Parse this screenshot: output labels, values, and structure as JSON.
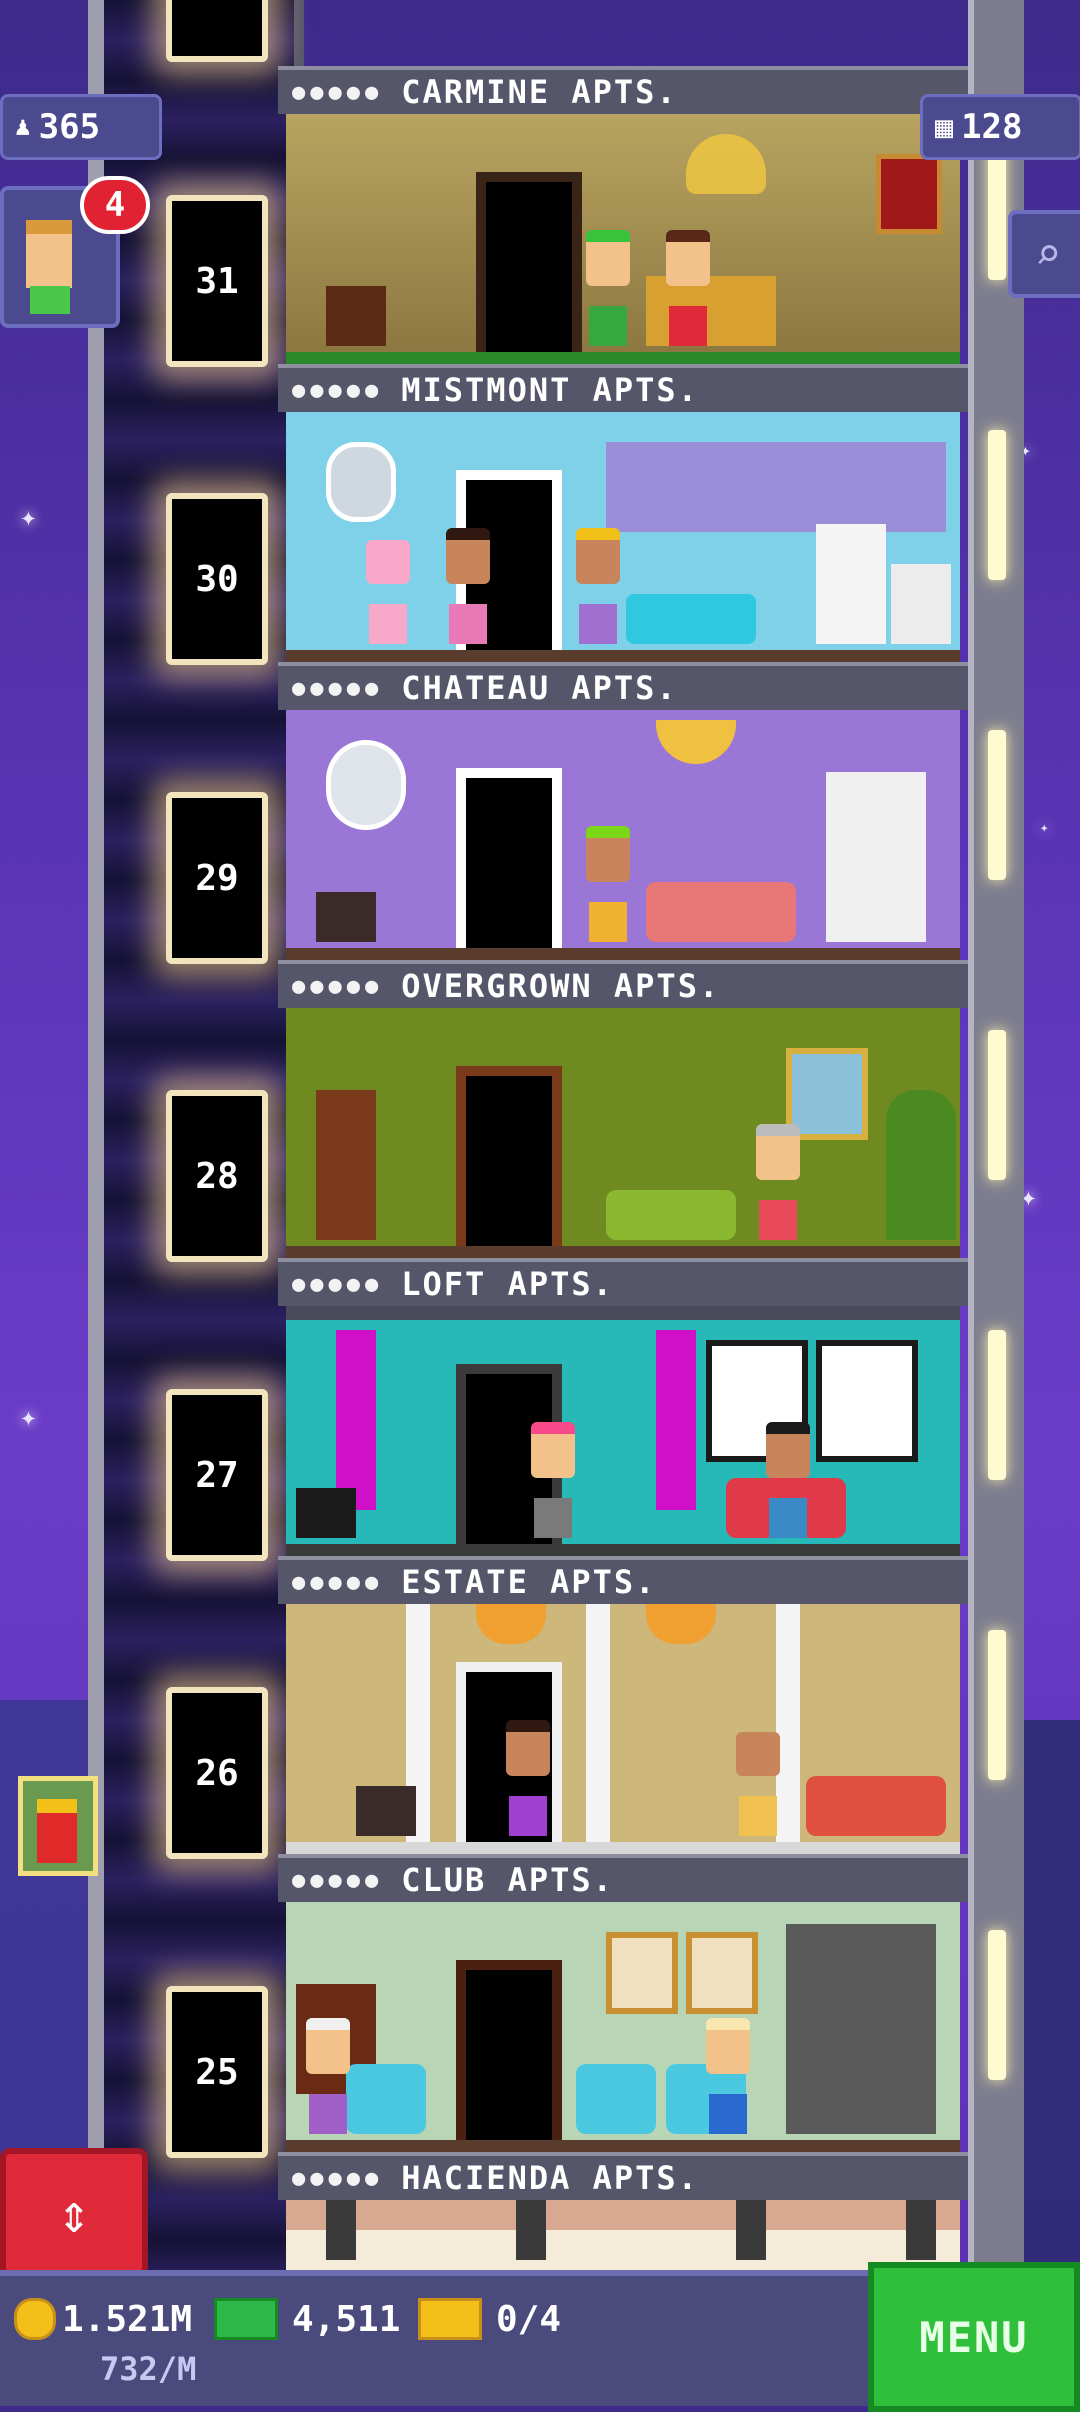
{
  "hud": {
    "population": "365",
    "population_icon": "person-icon",
    "floors": "128",
    "floors_icon": "building-icon",
    "notification_count": "4"
  },
  "elevator": {
    "floor_numbers": [
      "31",
      "30",
      "29",
      "28",
      "27",
      "26",
      "25"
    ]
  },
  "floors": [
    {
      "name": "CARMINE APTS.",
      "wall": "#c8b46a"
    },
    {
      "name": "MISTMONT APTS.",
      "wall": "#7fd1ea"
    },
    {
      "name": "CHATEAU APTS.",
      "wall": "#9a77d6"
    },
    {
      "name": "OVERGROWN APTS.",
      "wall": "#6f8a20"
    },
    {
      "name": "LOFT APTS.",
      "wall": "#27b8b8"
    },
    {
      "name": "ESTATE APTS.",
      "wall": "#cdb77a"
    },
    {
      "name": "CLUB APTS.",
      "wall": "#b8d6b6"
    },
    {
      "name": "HACIENDA APTS.",
      "wall": "#d8a890"
    }
  ],
  "bottom_bar": {
    "coins": "1.521M",
    "coins_rate": "732/M",
    "bux": "4,511",
    "tickets": "0/4",
    "menu_label": "MENU"
  },
  "colors": {
    "menu_green": "#2fbf3a",
    "toggle_red": "#e02a3a",
    "notify_red": "#e02233"
  }
}
